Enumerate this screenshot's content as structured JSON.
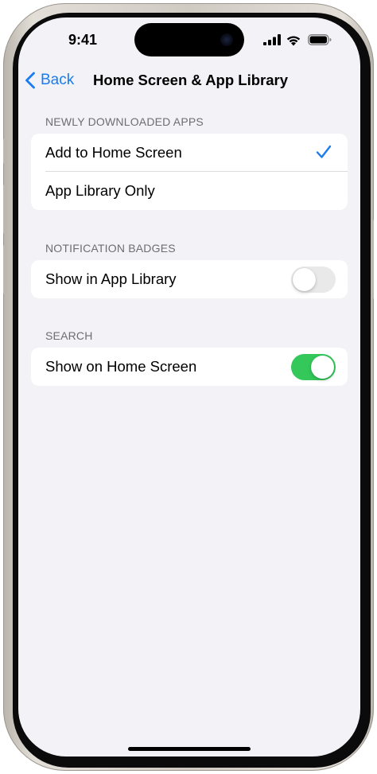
{
  "status_bar": {
    "time": "9:41",
    "icons": [
      "signal-icon",
      "wifi-icon",
      "battery-icon"
    ]
  },
  "nav": {
    "back_label": "Back",
    "title": "Home Screen & App Library"
  },
  "sections": [
    {
      "header": "NEWLY DOWNLOADED APPS",
      "rows": [
        {
          "label": "Add to Home Screen",
          "selected": true
        },
        {
          "label": "App Library Only",
          "selected": false
        }
      ]
    },
    {
      "header": "NOTIFICATION BADGES",
      "rows": [
        {
          "label": "Show in App Library",
          "toggle": false
        }
      ]
    },
    {
      "header": "SEARCH",
      "rows": [
        {
          "label": "Show on Home Screen",
          "toggle": true
        }
      ]
    }
  ],
  "colors": {
    "accent": "#1a7cf0",
    "toggle_on": "#34c759",
    "toggle_off": "#e9e9ea",
    "background": "#f2f2f7"
  }
}
